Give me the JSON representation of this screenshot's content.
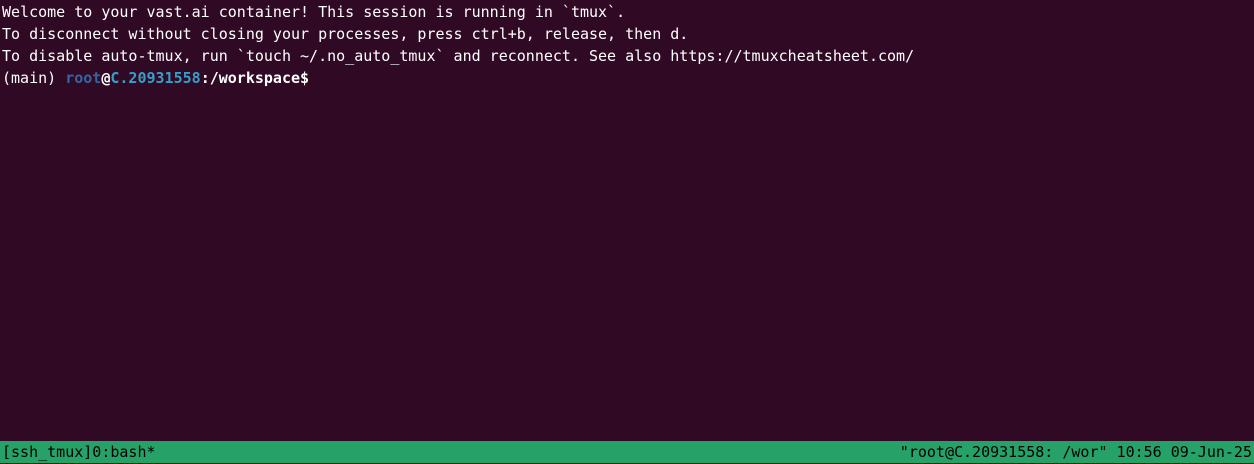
{
  "terminal": {
    "lines": [
      "Welcome to your vast.ai container! This session is running in `tmux`.",
      "To disconnect without closing your processes, press ctrl+b, release, then d.",
      "To disable auto-tmux, run `touch ~/.no_auto_tmux` and reconnect. See also https://tmuxcheatsheet.com/"
    ],
    "prompt": {
      "env": "(main) ",
      "user": "root",
      "at": "@",
      "host": "C.20931558",
      "path": ":/workspace$"
    }
  },
  "status_bar": {
    "left": "[ssh_tmux]0:bash*",
    "right": "\"root@C.20931558: /wor\" 10:56 09-Jun-25"
  },
  "colors": {
    "background": "#300a24",
    "status_bar": "#26a269",
    "prompt_user": "#3465a4",
    "prompt_host": "#34a0c9"
  }
}
